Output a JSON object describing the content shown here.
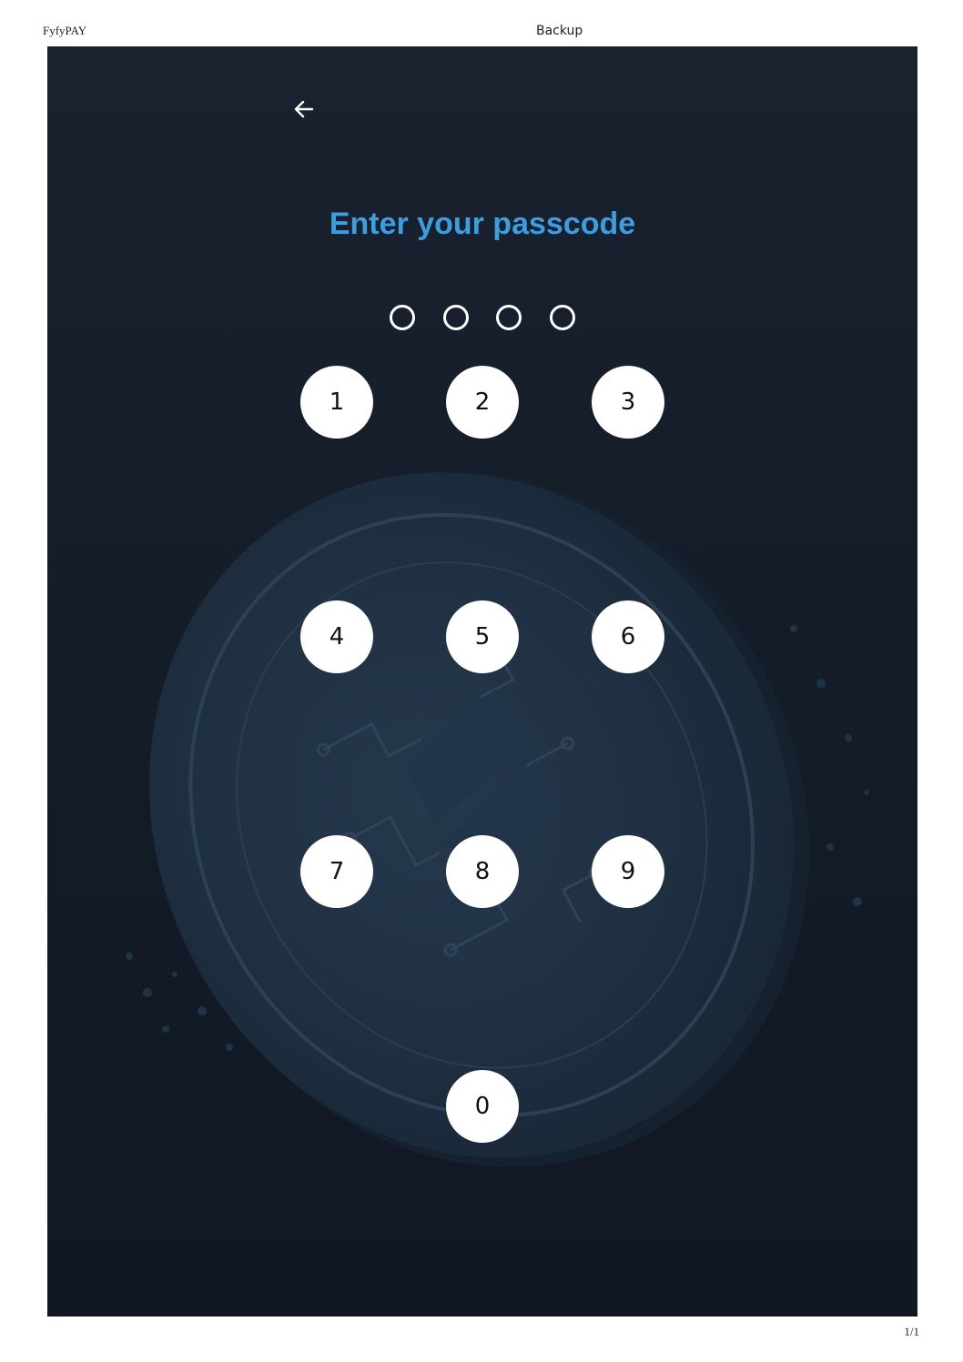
{
  "document": {
    "app_name": "FyfyPAY",
    "page_title": "Backup",
    "page_number": "1/1"
  },
  "screen": {
    "back_icon": "arrow-left-icon",
    "title": "Enter your passcode",
    "title_color": "#3a9ee0",
    "passcode_length": 4,
    "entered_digits": 0,
    "keypad": {
      "keys": [
        "1",
        "2",
        "3",
        "4",
        "5",
        "6",
        "7",
        "8",
        "9",
        "0"
      ]
    }
  }
}
